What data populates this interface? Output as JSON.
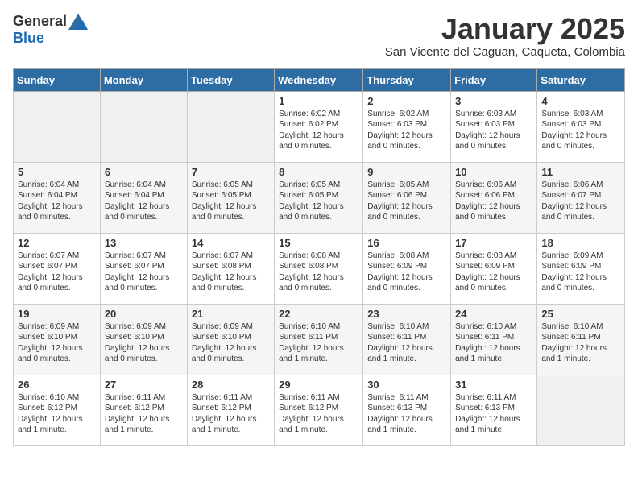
{
  "logo": {
    "general": "General",
    "blue": "Blue"
  },
  "title": "January 2025",
  "location": "San Vicente del Caguan, Caqueta, Colombia",
  "days_of_week": [
    "Sunday",
    "Monday",
    "Tuesday",
    "Wednesday",
    "Thursday",
    "Friday",
    "Saturday"
  ],
  "weeks": [
    [
      {
        "day": "",
        "info": ""
      },
      {
        "day": "",
        "info": ""
      },
      {
        "day": "",
        "info": ""
      },
      {
        "day": "1",
        "info": "Sunrise: 6:02 AM\nSunset: 6:02 PM\nDaylight: 12 hours\nand 0 minutes."
      },
      {
        "day": "2",
        "info": "Sunrise: 6:02 AM\nSunset: 6:03 PM\nDaylight: 12 hours\nand 0 minutes."
      },
      {
        "day": "3",
        "info": "Sunrise: 6:03 AM\nSunset: 6:03 PM\nDaylight: 12 hours\nand 0 minutes."
      },
      {
        "day": "4",
        "info": "Sunrise: 6:03 AM\nSunset: 6:03 PM\nDaylight: 12 hours\nand 0 minutes."
      }
    ],
    [
      {
        "day": "5",
        "info": "Sunrise: 6:04 AM\nSunset: 6:04 PM\nDaylight: 12 hours\nand 0 minutes."
      },
      {
        "day": "6",
        "info": "Sunrise: 6:04 AM\nSunset: 6:04 PM\nDaylight: 12 hours\nand 0 minutes."
      },
      {
        "day": "7",
        "info": "Sunrise: 6:05 AM\nSunset: 6:05 PM\nDaylight: 12 hours\nand 0 minutes."
      },
      {
        "day": "8",
        "info": "Sunrise: 6:05 AM\nSunset: 6:05 PM\nDaylight: 12 hours\nand 0 minutes."
      },
      {
        "day": "9",
        "info": "Sunrise: 6:05 AM\nSunset: 6:06 PM\nDaylight: 12 hours\nand 0 minutes."
      },
      {
        "day": "10",
        "info": "Sunrise: 6:06 AM\nSunset: 6:06 PM\nDaylight: 12 hours\nand 0 minutes."
      },
      {
        "day": "11",
        "info": "Sunrise: 6:06 AM\nSunset: 6:07 PM\nDaylight: 12 hours\nand 0 minutes."
      }
    ],
    [
      {
        "day": "12",
        "info": "Sunrise: 6:07 AM\nSunset: 6:07 PM\nDaylight: 12 hours\nand 0 minutes."
      },
      {
        "day": "13",
        "info": "Sunrise: 6:07 AM\nSunset: 6:07 PM\nDaylight: 12 hours\nand 0 minutes."
      },
      {
        "day": "14",
        "info": "Sunrise: 6:07 AM\nSunset: 6:08 PM\nDaylight: 12 hours\nand 0 minutes."
      },
      {
        "day": "15",
        "info": "Sunrise: 6:08 AM\nSunset: 6:08 PM\nDaylight: 12 hours\nand 0 minutes."
      },
      {
        "day": "16",
        "info": "Sunrise: 6:08 AM\nSunset: 6:09 PM\nDaylight: 12 hours\nand 0 minutes."
      },
      {
        "day": "17",
        "info": "Sunrise: 6:08 AM\nSunset: 6:09 PM\nDaylight: 12 hours\nand 0 minutes."
      },
      {
        "day": "18",
        "info": "Sunrise: 6:09 AM\nSunset: 6:09 PM\nDaylight: 12 hours\nand 0 minutes."
      }
    ],
    [
      {
        "day": "19",
        "info": "Sunrise: 6:09 AM\nSunset: 6:10 PM\nDaylight: 12 hours\nand 0 minutes."
      },
      {
        "day": "20",
        "info": "Sunrise: 6:09 AM\nSunset: 6:10 PM\nDaylight: 12 hours\nand 0 minutes."
      },
      {
        "day": "21",
        "info": "Sunrise: 6:09 AM\nSunset: 6:10 PM\nDaylight: 12 hours\nand 0 minutes."
      },
      {
        "day": "22",
        "info": "Sunrise: 6:10 AM\nSunset: 6:11 PM\nDaylight: 12 hours\nand 1 minute."
      },
      {
        "day": "23",
        "info": "Sunrise: 6:10 AM\nSunset: 6:11 PM\nDaylight: 12 hours\nand 1 minute."
      },
      {
        "day": "24",
        "info": "Sunrise: 6:10 AM\nSunset: 6:11 PM\nDaylight: 12 hours\nand 1 minute."
      },
      {
        "day": "25",
        "info": "Sunrise: 6:10 AM\nSunset: 6:11 PM\nDaylight: 12 hours\nand 1 minute."
      }
    ],
    [
      {
        "day": "26",
        "info": "Sunrise: 6:10 AM\nSunset: 6:12 PM\nDaylight: 12 hours\nand 1 minute."
      },
      {
        "day": "27",
        "info": "Sunrise: 6:11 AM\nSunset: 6:12 PM\nDaylight: 12 hours\nand 1 minute."
      },
      {
        "day": "28",
        "info": "Sunrise: 6:11 AM\nSunset: 6:12 PM\nDaylight: 12 hours\nand 1 minute."
      },
      {
        "day": "29",
        "info": "Sunrise: 6:11 AM\nSunset: 6:12 PM\nDaylight: 12 hours\nand 1 minute."
      },
      {
        "day": "30",
        "info": "Sunrise: 6:11 AM\nSunset: 6:13 PM\nDaylight: 12 hours\nand 1 minute."
      },
      {
        "day": "31",
        "info": "Sunrise: 6:11 AM\nSunset: 6:13 PM\nDaylight: 12 hours\nand 1 minute."
      },
      {
        "day": "",
        "info": ""
      }
    ]
  ]
}
